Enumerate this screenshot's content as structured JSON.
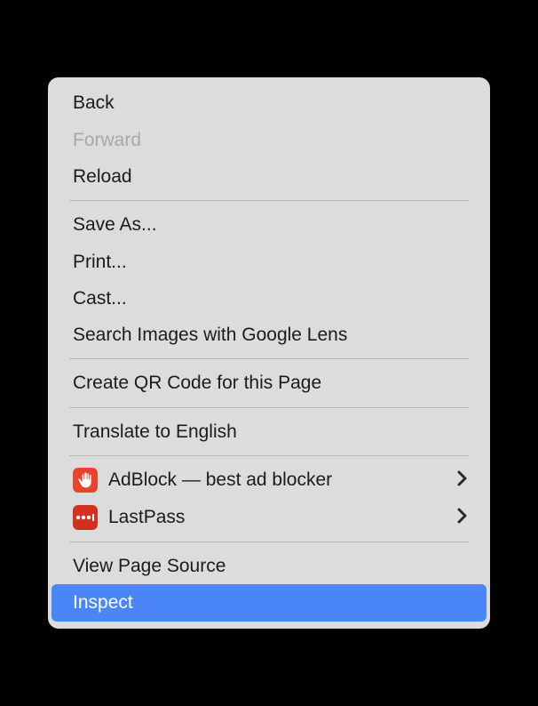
{
  "menu": {
    "back": "Back",
    "forward": "Forward",
    "reload": "Reload",
    "saveAs": "Save As...",
    "print": "Print...",
    "cast": "Cast...",
    "searchImages": "Search Images with Google Lens",
    "createQr": "Create QR Code for this Page",
    "translate": "Translate to English",
    "adblock": "AdBlock — best ad blocker",
    "lastpass": "LastPass",
    "viewSource": "View Page Source",
    "inspect": "Inspect"
  }
}
